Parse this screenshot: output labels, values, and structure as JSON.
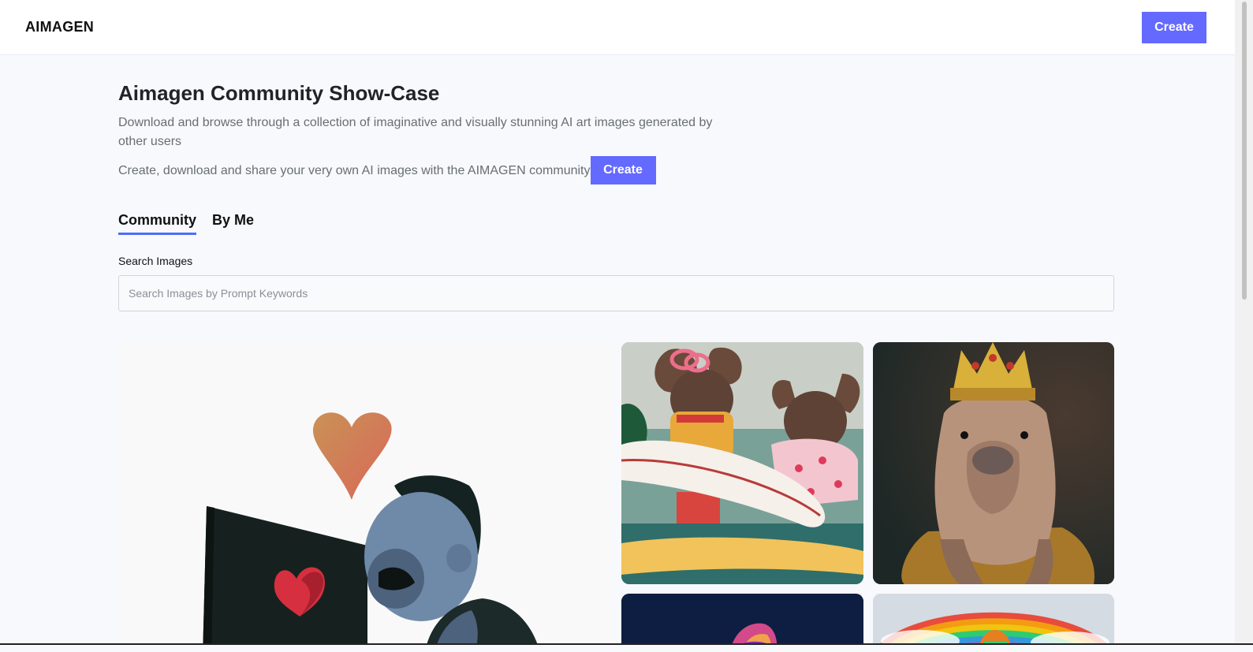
{
  "header": {
    "logo": "AIMAGEN",
    "create_label": "Create"
  },
  "hero": {
    "title": "Aimagen Community Show-Case",
    "description": "Download and browse through a collection of imaginative and visually stunning AI art images generated by other users",
    "cta_text": "Create, download and share your very own AI images with the AIMAGEN community",
    "cta_button": "Create"
  },
  "tabs": [
    {
      "label": "Community",
      "active": true
    },
    {
      "label": "By Me",
      "active": false
    }
  ],
  "search": {
    "label": "Search Images",
    "placeholder": "Search Images by Prompt Keywords",
    "value": ""
  },
  "colors": {
    "accent": "#6469ff",
    "tab_underline": "#4c6ef5",
    "page_bg": "#f8f9fc"
  }
}
